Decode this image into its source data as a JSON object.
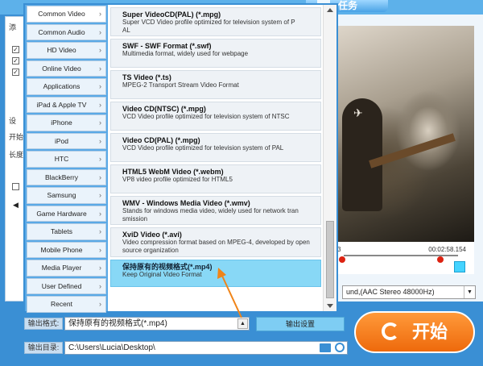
{
  "top_tab_label": "任务",
  "left_panel": {
    "labels": [
      "添",
      "设",
      "开始",
      "长度"
    ]
  },
  "timeline": {
    "start_time": "3",
    "end_time": "00:02:58.154"
  },
  "audio_select": {
    "value": "und,(AAC Stereo 48000Hz)"
  },
  "dropdown": {
    "categories": [
      "Common Video",
      "Common Audio",
      "HD Video",
      "Online Video",
      "Applications",
      "iPad & Apple TV",
      "iPhone",
      "iPod",
      "HTC",
      "BlackBerry",
      "Samsung",
      "Game Hardware",
      "Tablets",
      "Mobile Phone",
      "Media Player",
      "User Defined",
      "Recent"
    ],
    "active_category": "Common Video",
    "formats": [
      {
        "title": "Super VideoCD(PAL) (*.mpg)",
        "desc": [
          "Super VCD Video profile optimized for television system of P",
          "AL"
        ]
      },
      {
        "title": "SWF - SWF Format (*.swf)",
        "desc": [
          "Multimedia format, widely used for webpage"
        ]
      },
      {
        "title": "TS Video (*.ts)",
        "desc": [
          "MPEG-2 Transport Stream Video Format"
        ]
      },
      {
        "title": "Video CD(NTSC) (*.mpg)",
        "desc": [
          "VCD Video profile optimized for television system of NTSC"
        ]
      },
      {
        "title": "Video CD(PAL) (*.mpg)",
        "desc": [
          "VCD Video profile optimized for television system of PAL"
        ]
      },
      {
        "title": "HTML5 WebM Video (*.webm)",
        "desc": [
          "VP8 video profile optimized for HTML5"
        ]
      },
      {
        "title": "WMV - Windows Media Video (*.wmv)",
        "desc": [
          "Stands for windows media video, widely used for network tran",
          "smission"
        ]
      },
      {
        "title": "XviD Video (*.avi)",
        "desc": [
          "Video compression format based on MPEG-4, developed by open",
          "source organization"
        ]
      },
      {
        "title": "保持原有的视频格式(*.mp4)",
        "desc": [
          "Keep Original Video Format"
        ],
        "selected": true
      }
    ]
  },
  "output_format": {
    "label": "输出格式:",
    "value": "保持原有的视频格式(*.mp4)"
  },
  "settings_button": "输出设置",
  "output_dir": {
    "label": "输出目录:",
    "value": "C:\\Users\\Lucia\\Desktop\\"
  },
  "start_button": "开始",
  "colors": {
    "accent": "#3a8fd4",
    "start": "#f07a18",
    "selected": "#88d8f6"
  }
}
